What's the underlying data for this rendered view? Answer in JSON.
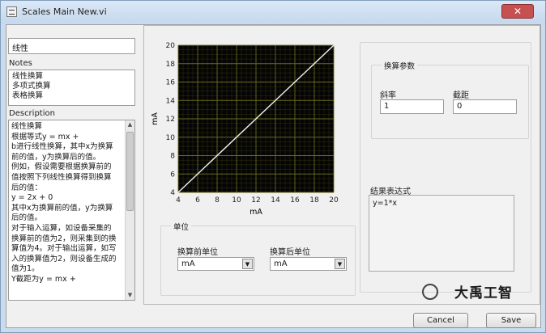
{
  "window": {
    "title": "Scales Main New.vi"
  },
  "left": {
    "name_value": "线性",
    "notes_label": "Notes",
    "notes_items": [
      "线性换算",
      "多项式换算",
      "表格换算"
    ],
    "description_label": "Description",
    "description_lines": [
      "线性换算",
      "根据等式y = mx +",
      "b进行线性换算，其中x为换算",
      "前的值，y为换算后的值。",
      "例如，假设需要根据换算前的",
      "值按照下列线性换算得到换算",
      "后的值：",
      "y = 2x + 0",
      "其中x为换算前的值，y为换算",
      "后的值。",
      "对于输入运算，如设备采集的",
      "换算前的值为2，则采集到的换",
      "算值为4。对于输出运算，如写",
      "入的换算值为2，则设备生成的",
      "值为1。",
      "Y截距为y = mx +"
    ]
  },
  "graph": {
    "x_label": "mA",
    "y_label": "mA",
    "x_ticks": [
      "4",
      "6",
      "8",
      "10",
      "12",
      "14",
      "16",
      "18",
      "20"
    ],
    "y_ticks": [
      "20",
      "18",
      "16",
      "14",
      "12",
      "10",
      "8",
      "6",
      "4"
    ]
  },
  "chart_data": {
    "type": "line",
    "xlabel": "mA",
    "ylabel": "mA",
    "xlim": [
      4,
      20
    ],
    "ylim": [
      4,
      20
    ],
    "grid": true,
    "series": [
      {
        "x": [
          4,
          20
        ],
        "y": [
          4,
          20
        ]
      }
    ]
  },
  "units": {
    "group_title": "单位",
    "pre_label": "换算前单位",
    "pre_value": "mA",
    "post_label": "换算后单位",
    "post_value": "mA"
  },
  "params": {
    "group_title": "换算参数",
    "slope_label": "斜率",
    "slope_value": "1",
    "intercept_label": "截距",
    "intercept_value": "0"
  },
  "expression": {
    "label": "结果表达式",
    "value": "y=1*x"
  },
  "buttons": {
    "cancel": "Cancel",
    "save": "Save"
  },
  "watermark": {
    "text": "大禹工智"
  },
  "colors": {
    "plot_bg": "#050505",
    "grid_major": "#6b6a1e",
    "trace": "#f2f2f2"
  }
}
